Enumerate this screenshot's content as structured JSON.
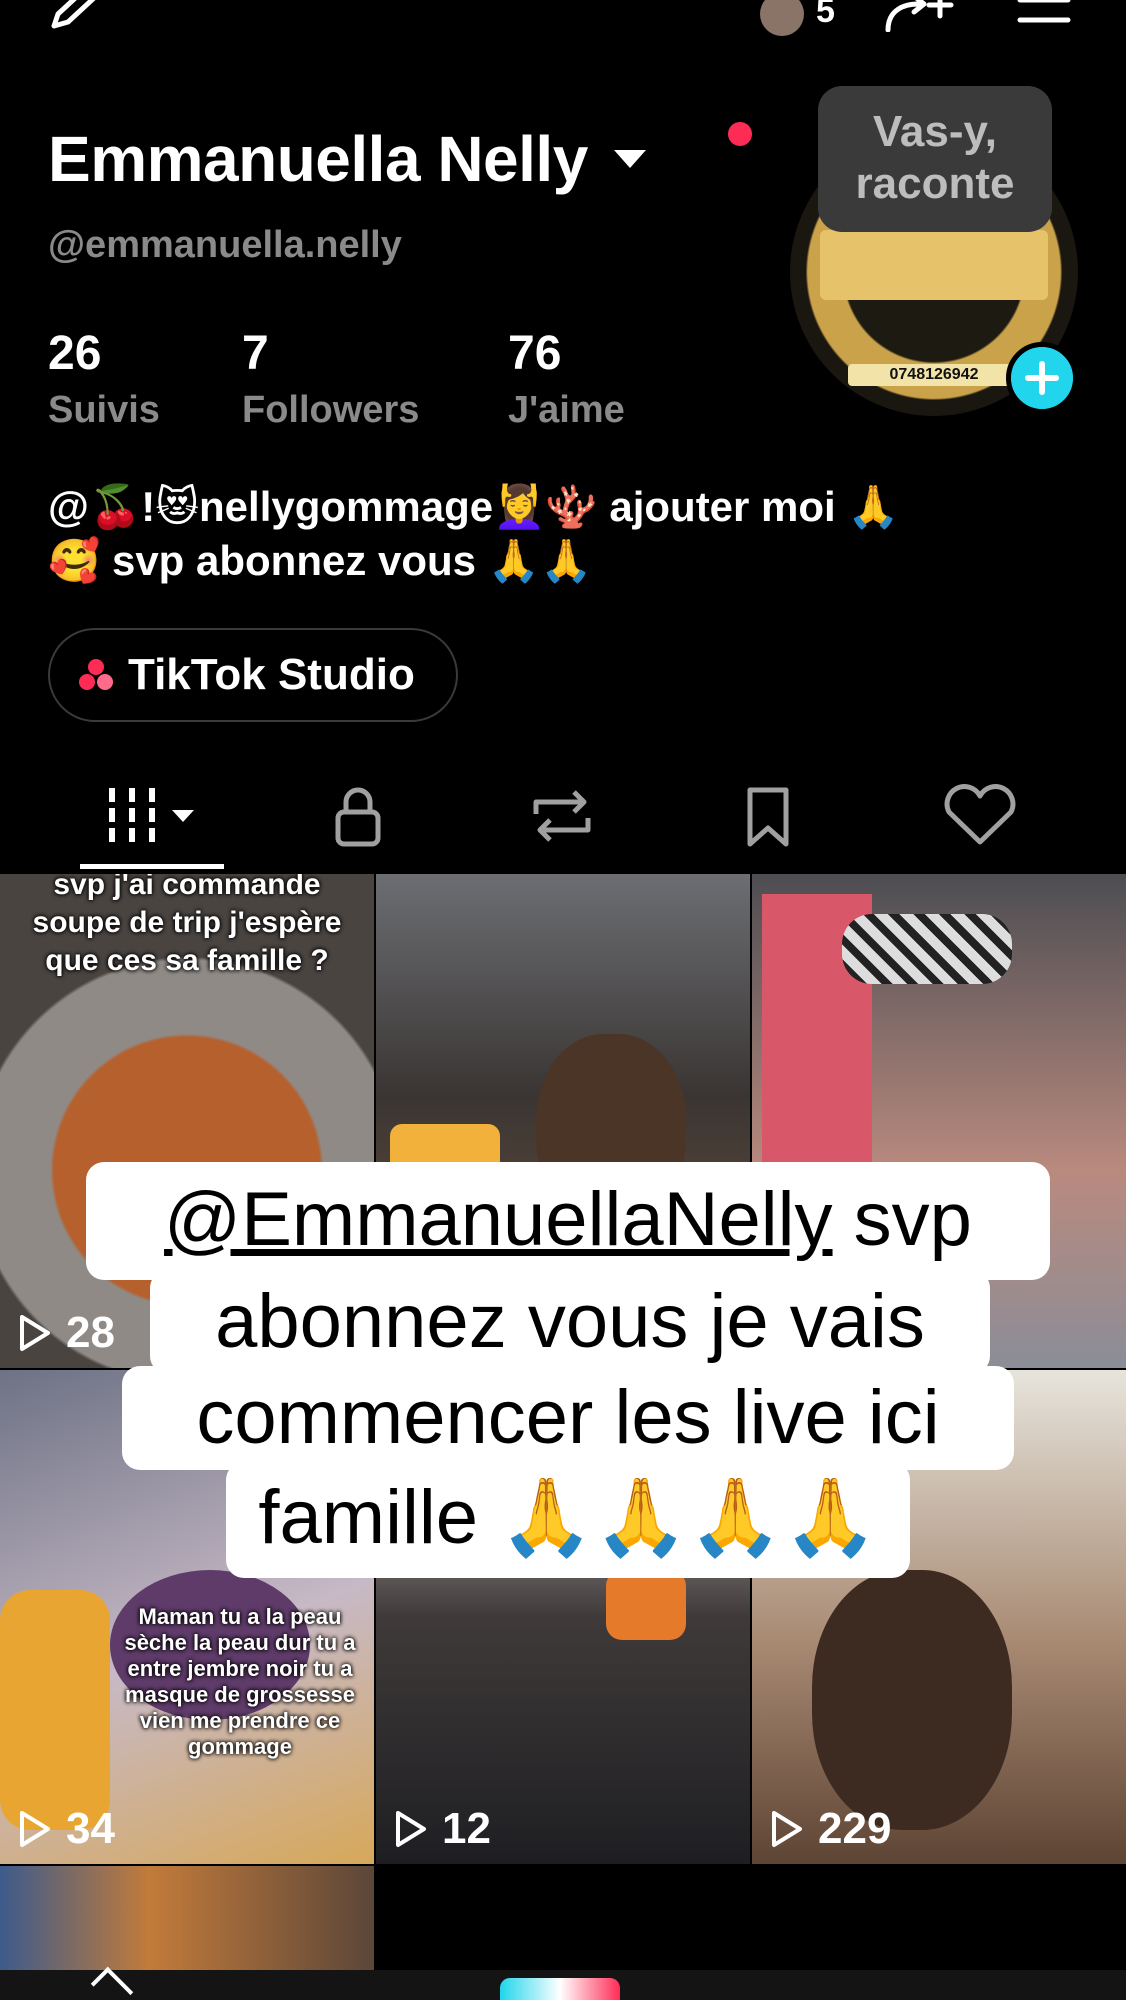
{
  "topbar": {
    "friends_count": "5"
  },
  "profile": {
    "name": "Emmanuella Nelly",
    "handle": "@emmanuella.nelly",
    "story_bubble_line1": "Vas-y,",
    "story_bubble_line2": "raconte",
    "avatar_phone": "0748126942",
    "stats": [
      {
        "value": "26",
        "label": "Suivis"
      },
      {
        "value": "7",
        "label": "Followers"
      },
      {
        "value": "76",
        "label": "J'aime"
      }
    ],
    "bio_line1": "@🍒!😻nellygommage💆‍♀️🪸  ajouter moi 🙏",
    "bio_line2": "🥰 svp abonnez vous 🙏🙏",
    "studio_label": "TikTok Studio"
  },
  "tabs": [
    "videos-tab",
    "private-tab",
    "reposts-tab",
    "favorites-tab",
    "liked-tab"
  ],
  "videos": [
    {
      "views": "28",
      "caption": "svp j'ai commande soupe de trip j'espère que ces sa famille ?"
    },
    {
      "views": "",
      "caption": ""
    },
    {
      "views": "",
      "caption": ""
    },
    {
      "views": "34",
      "caption": "Maman tu a la peau sèche la peau dur tu a entre jembre noir tu a masque de grossesse vien me prendre ce gommage"
    },
    {
      "views": "12",
      "caption": ""
    },
    {
      "views": "229",
      "caption": ""
    }
  ],
  "overlay": {
    "mention": "@EmmanuellaNelly",
    "line1_rest": "  svp",
    "line2": "abonnez vous je vais",
    "line3": "commencer les live ici",
    "line4": "famille 🙏🙏🙏🙏"
  },
  "colors": {
    "accent_red": "#fe2c55",
    "accent_cyan": "#20d5ec",
    "secondary_text": "#8a8a8a"
  }
}
